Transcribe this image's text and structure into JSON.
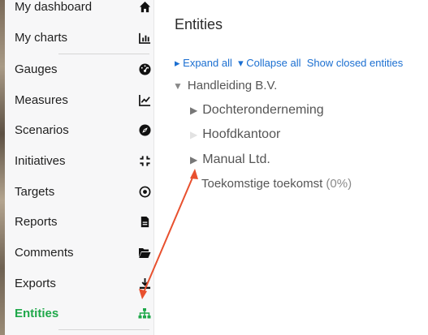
{
  "sidebar": {
    "items": [
      {
        "label": "My dashboard",
        "icon": "home-icon"
      },
      {
        "label": "My charts",
        "icon": "bar-chart-icon"
      },
      {
        "label": "Gauges",
        "icon": "gauge-icon"
      },
      {
        "label": "Measures",
        "icon": "line-chart-icon"
      },
      {
        "label": "Scenarios",
        "icon": "compass-icon"
      },
      {
        "label": "Initiatives",
        "icon": "compress-icon"
      },
      {
        "label": "Targets",
        "icon": "target-icon"
      },
      {
        "label": "Reports",
        "icon": "document-icon"
      },
      {
        "label": "Comments",
        "icon": "folder-open-icon"
      },
      {
        "label": "Exports",
        "icon": "download-icon"
      },
      {
        "label": "Entities",
        "icon": "org-chart-icon",
        "active": true
      }
    ]
  },
  "main": {
    "title": "Entities",
    "actions": {
      "expand_all": "Expand all",
      "collapse_all": "Collapse all",
      "show_closed": "Show closed entities"
    },
    "tree": {
      "root": "Handleiding B.V.",
      "children": [
        {
          "label": "Dochteronderneming",
          "state": "collapsed"
        },
        {
          "label": "Hoofdkantoor",
          "state": "empty"
        },
        {
          "label": "Manual Ltd.",
          "state": "collapsed"
        },
        {
          "label": "Toekomstige toekomst",
          "suffix": "(0%)",
          "state": "leaf"
        }
      ]
    }
  },
  "colors": {
    "active": "#1fa84a",
    "link": "#1b6fd1",
    "annotation_arrow": "#e8502e"
  }
}
